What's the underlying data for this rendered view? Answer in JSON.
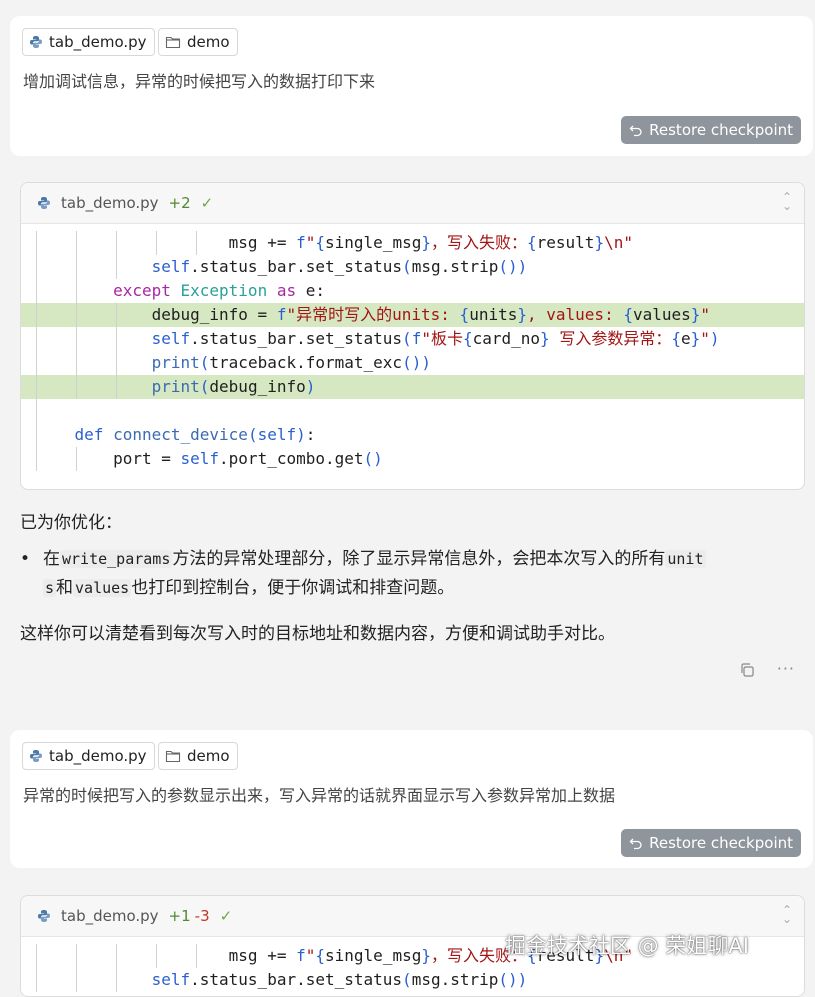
{
  "message1": {
    "chips": [
      {
        "icon": "python-file-icon",
        "label": "tab_demo.py"
      },
      {
        "icon": "folder-icon",
        "label": "demo"
      }
    ],
    "text": "增加调试信息，异常的时候把写入的数据打印下来",
    "restore_label": "Restore checkpoint"
  },
  "code1": {
    "filename": "tab_demo.py",
    "adds": "+2",
    "dels": ""
  },
  "assistant": {
    "intro": "已为你优化：",
    "bullet": {
      "p1": "在",
      "code1": "write_params",
      "p2": "方法的异常处理部分，除了显示异常信息外，会把本次写入的所有",
      "code2a": "unit",
      "code2b": "s",
      "p3": "和",
      "code3": "values",
      "p4": "也打印到控制台，便于你调试和排查问题。"
    },
    "closing": "这样你可以清楚看到每次写入时的目标地址和数据内容，方便和调试助手对比。"
  },
  "message2": {
    "chips": [
      {
        "icon": "python-file-icon",
        "label": "tab_demo.py"
      },
      {
        "icon": "folder-icon",
        "label": "demo"
      }
    ],
    "text": "异常的时候把写入的参数显示出来，写入异常的话就界面显示写入参数异常加上数据",
    "restore_label": "Restore checkpoint"
  },
  "code2": {
    "filename": "tab_demo.py",
    "adds": "+1",
    "dels": "-3"
  },
  "watermark": "掘金技术社区 @ 荣姐聊AI",
  "colors": {
    "highlight": "#d5e8c2",
    "restore_button": "#8f959c",
    "keyword": "#a626a4",
    "string": "#a31515"
  }
}
